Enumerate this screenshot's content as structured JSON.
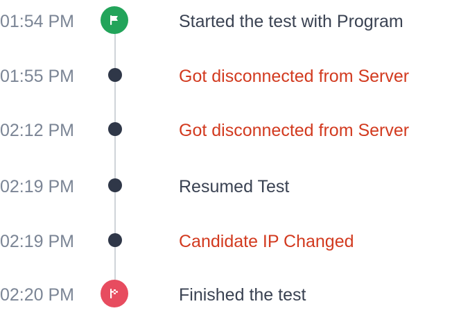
{
  "colors": {
    "time_text": "#7b8595",
    "normal_text": "#3a4252",
    "alert_text": "#d23a1f",
    "start_badge": "#22a45a",
    "finish_badge": "#e74c5f",
    "dot": "#2f3748",
    "rail": "#cfd3d8"
  },
  "events": [
    {
      "time": "01:54 PM",
      "text": "Started the test with Program",
      "kind": "start",
      "icon": "flag-icon"
    },
    {
      "time": "01:55 PM",
      "text": "Got disconnected from Server",
      "kind": "alert",
      "icon": "dot"
    },
    {
      "time": "02:12 PM",
      "text": "Got disconnected from Server",
      "kind": "alert",
      "icon": "dot"
    },
    {
      "time": "02:19 PM",
      "text": "Resumed Test",
      "kind": "normal",
      "icon": "dot"
    },
    {
      "time": "02:19 PM",
      "text": "Candidate IP Changed",
      "kind": "alert",
      "icon": "dot"
    },
    {
      "time": "02:20 PM",
      "text": "Finished the test",
      "kind": "finish",
      "icon": "checkered-flag-icon"
    }
  ]
}
